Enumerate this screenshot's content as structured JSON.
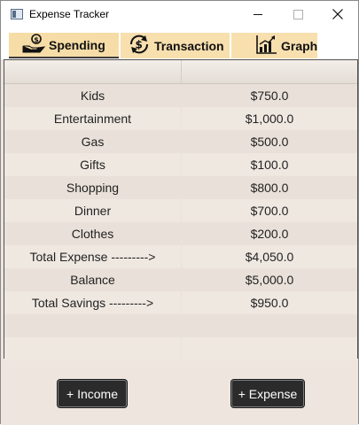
{
  "window": {
    "title": "Expense Tracker"
  },
  "tabs": [
    {
      "label": "Spending",
      "icon": "money-hand-icon"
    },
    {
      "label": "Transaction",
      "icon": "dollar-cycle-icon"
    },
    {
      "label": "Graph",
      "icon": "bar-chart-icon"
    }
  ],
  "table": {
    "rows": [
      {
        "category": "Kids",
        "amount": "$750.0"
      },
      {
        "category": "Entertainment",
        "amount": "$1,000.0"
      },
      {
        "category": "Gas",
        "amount": "$500.0"
      },
      {
        "category": "Gifts",
        "amount": "$100.0"
      },
      {
        "category": "Shopping",
        "amount": "$800.0"
      },
      {
        "category": "Dinner",
        "amount": "$700.0"
      },
      {
        "category": "Clothes",
        "amount": "$200.0"
      },
      {
        "category": "Total Expense  --------->",
        "amount": "$4,050.0"
      },
      {
        "category": "Balance",
        "amount": "$5,000.0"
      },
      {
        "category": "Total Savings  --------->",
        "amount": "$950.0"
      },
      {
        "category": "",
        "amount": ""
      },
      {
        "category": "",
        "amount": ""
      }
    ]
  },
  "buttons": {
    "income": "+ Income",
    "expense": "+ Expense"
  }
}
